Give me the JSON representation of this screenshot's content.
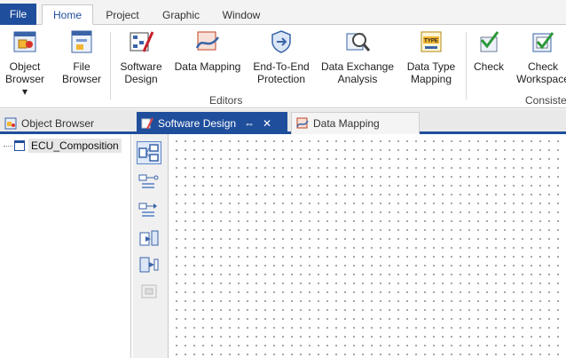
{
  "menu": {
    "file": "File",
    "tabs": [
      "Home",
      "Project",
      "Graphic",
      "Window"
    ],
    "active_tab": "Home"
  },
  "ribbon": {
    "buttons": [
      {
        "label": "Object\nBrowser ▾",
        "icon": "object-browser-icon"
      },
      {
        "label": "File\nBrowser",
        "icon": "file-browser-icon"
      },
      {
        "label": "Software\nDesign",
        "icon": "software-design-icon"
      },
      {
        "label": "Data Mapping",
        "icon": "data-mapping-icon"
      },
      {
        "label": "End-To-End\nProtection",
        "icon": "end-to-end-protection-icon"
      },
      {
        "label": "Data Exchange\nAnalysis",
        "icon": "data-exchange-analysis-icon"
      },
      {
        "label": "Data Type\nMapping",
        "icon": "data-type-mapping-icon"
      },
      {
        "label": "Check",
        "icon": "check-icon"
      },
      {
        "label": "Check\nWorkspace",
        "icon": "check-workspace-icon"
      }
    ],
    "groups": [
      "Editors",
      "Consiste"
    ],
    "type_badge": "TYPE"
  },
  "doc_tabs": [
    {
      "label": "Object Browser",
      "active": false
    },
    {
      "label": "Software Design",
      "active": true
    },
    {
      "label": "Data Mapping",
      "active": false
    }
  ],
  "tab_controls": {
    "pin": "⇔",
    "close": "✕"
  },
  "tree": {
    "root": "ECU_Composition"
  },
  "vtoolbar": [
    "component-view-icon",
    "connector-left-icon",
    "connector-right-icon",
    "port-in-icon",
    "port-out-icon",
    "disabled-tool-icon"
  ],
  "colors": {
    "accent": "#1f4e9c",
    "toolbar_bg": "#f0f0f0",
    "tab_strip": "#e9e9e9"
  }
}
